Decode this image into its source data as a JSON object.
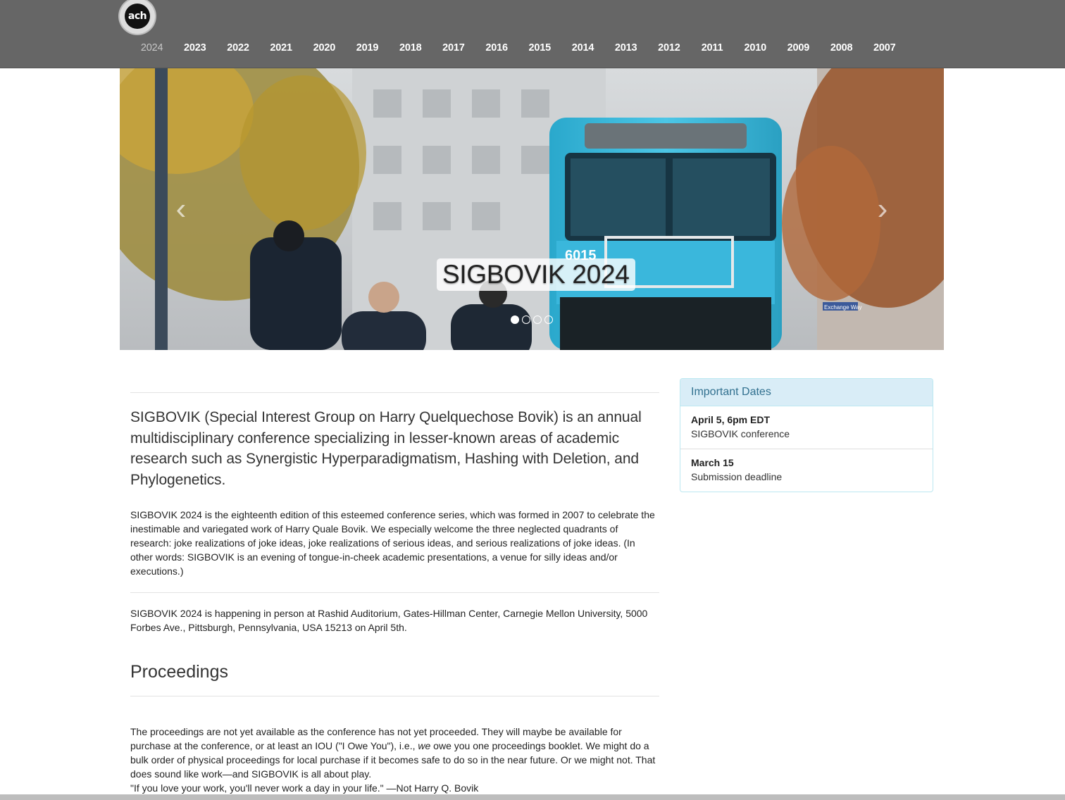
{
  "header": {
    "logo_text": "ach",
    "years": [
      "2024",
      "2023",
      "2022",
      "2021",
      "2020",
      "2019",
      "2018",
      "2017",
      "2016",
      "2015",
      "2014",
      "2013",
      "2012",
      "2011",
      "2010",
      "2009",
      "2008",
      "2007"
    ],
    "active_year": "2024"
  },
  "carousel": {
    "caption": "SIGBOVIK 2024",
    "bus_number": "6015",
    "street_sign": "Exchange Way",
    "prev_icon": "‹",
    "next_icon": "›",
    "slide_count": 4,
    "active_slide": 0
  },
  "main": {
    "lead": "SIGBOVIK (Special Interest Group on Harry Quelquechose Bovik) is an annual multidisciplinary conference specializing in lesser-known areas of academic research such as Synergistic Hyperparadigmatism, Hashing with Deletion, and Phylogenetics.",
    "intro": "SIGBOVIK 2024 is the eighteenth edition of this esteemed conference series, which was formed in 2007 to celebrate the inestimable and variegated work of Harry Quale Bovik. We especially welcome the three neglected quadrants of research: joke realizations of joke ideas, joke realizations of serious ideas, and serious realizations of joke ideas. (In other words: SIGBOVIK is an evening of tongue-in-cheek academic presentations, a venue for silly ideas and/or executions.)",
    "location": "SIGBOVIK 2024 is happening in person at Rashid Auditorium, Gates-Hillman Center, Carnegie Mellon University, 5000 Forbes Ave., Pittsburgh, Pennsylvania, USA 15213 on April 5th.",
    "proceedings_heading": "Proceedings",
    "proceedings_p1": "The proceedings are not yet available as the conference has not yet proceeded. They will maybe be available for purchase at the conference, or at least an IOU (\"I Owe You\"), i.e., ",
    "proceedings_em": "we",
    "proceedings_p2": " owe you one proceedings booklet. We might do a bulk order of physical proceedings for local purchase if it becomes safe to do so in the near future. Or we might not. That does sound like work—and SIGBOVIK is all about play.",
    "quote": "\"If you love your work, you'll never work a day in your life.\" —Not Harry Q. Bovik"
  },
  "sidebar": {
    "heading": "Important Dates",
    "dates": [
      {
        "date": "April 5, 6pm EDT",
        "event": "SIGBOVIK conference"
      },
      {
        "date": "March 15",
        "event": "Submission deadline"
      }
    ]
  },
  "colors": {
    "navbar": "#666666",
    "panel_heading_bg": "#d9edf7",
    "panel_heading_text": "#31708f",
    "bus": "#35b6d9"
  }
}
